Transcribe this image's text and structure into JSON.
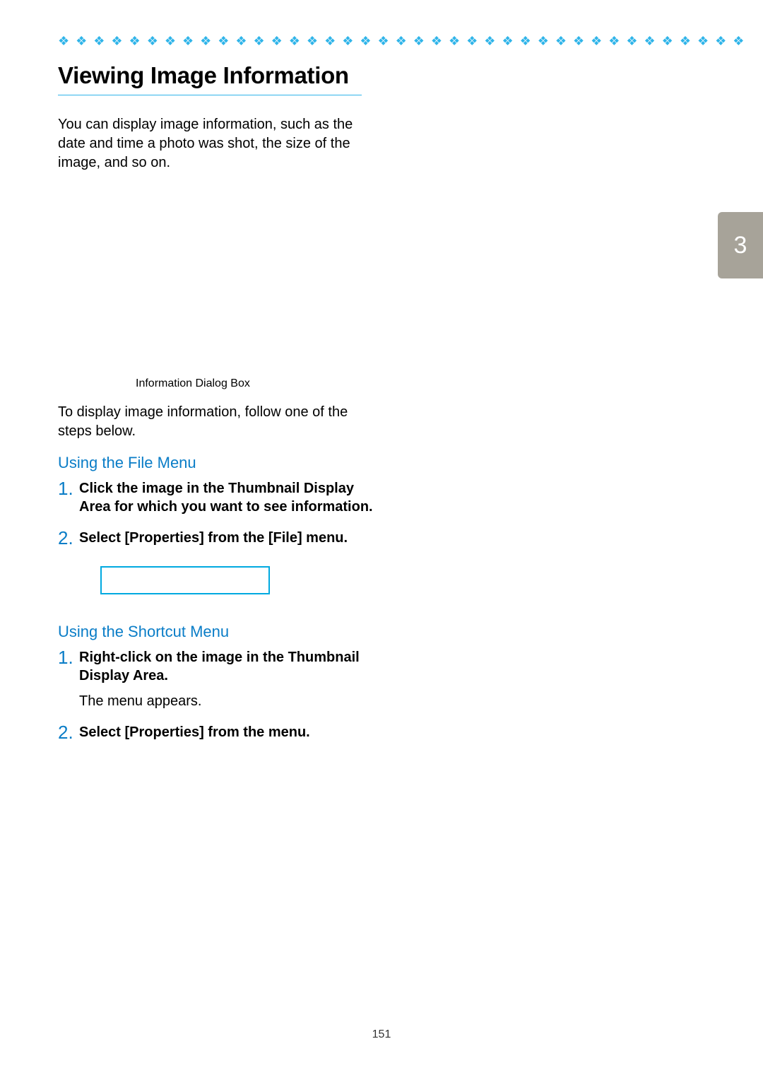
{
  "decor": {
    "diamonds": "❖ ❖ ❖ ❖ ❖ ❖ ❖ ❖ ❖ ❖ ❖ ❖ ❖ ❖ ❖ ❖ ❖ ❖ ❖ ❖ ❖ ❖ ❖ ❖ ❖ ❖ ❖ ❖ ❖ ❖ ❖ ❖ ❖ ❖ ❖ ❖ ❖ ❖ ❖ ❖ ❖ ❖ ❖ ❖ ❖ ❖ ❖ ❖ ❖ ❖ ❖ ❖ ❖ ❖ ❖ ❖ ❖ ❖ ❖ ❖"
  },
  "title": "Viewing Image Information",
  "intro": "You can display image information, such as the date and time a photo was shot, the size of the image, and so on.",
  "caption": "Information Dialog Box",
  "follow": "To display image information, follow one of the steps below.",
  "section1": {
    "heading": "Using the File Menu",
    "step1_num": "1.",
    "step1": "Click the image in the Thumbnail Display Area for which you want to see information.",
    "step2_num": "2.",
    "step2": "Select [Properties] from the [File] menu."
  },
  "section2": {
    "heading": "Using the Shortcut Menu",
    "step1_num": "1.",
    "step1": "Right-click on the image in the Thumbnail Display Area.",
    "step1_note": "The menu appears.",
    "step2_num": "2.",
    "step2": "Select [Properties] from the menu."
  },
  "chapter": "3",
  "pagenum": "151"
}
